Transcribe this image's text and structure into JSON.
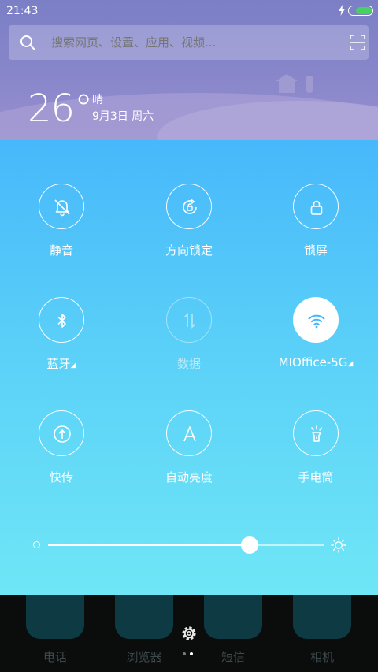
{
  "status_bar": {
    "time": "21:43"
  },
  "search": {
    "placeholder": "搜索网页、设置、应用、视频..."
  },
  "weather": {
    "temperature": "26°",
    "condition": "晴",
    "date": "9月3日 周六"
  },
  "toggles": [
    {
      "label": "静音",
      "icon": "silent-bell-icon",
      "state": "off"
    },
    {
      "label": "方向锁定",
      "icon": "rotation-lock-icon",
      "state": "off"
    },
    {
      "label": "锁屏",
      "icon": "lock-icon",
      "state": "off"
    },
    {
      "label": "蓝牙",
      "icon": "bluetooth-icon",
      "state": "off",
      "has_menu": true
    },
    {
      "label": "数据",
      "icon": "mobile-data-icon",
      "state": "disabled"
    },
    {
      "label": "MIOffice-5G",
      "icon": "wifi-icon",
      "state": "on",
      "has_menu": true
    },
    {
      "label": "快传",
      "icon": "quick-transfer-icon",
      "state": "off"
    },
    {
      "label": "自动亮度",
      "icon": "auto-brightness-icon",
      "state": "off"
    },
    {
      "label": "手电筒",
      "icon": "flashlight-icon",
      "state": "off"
    }
  ],
  "brightness": {
    "level": 0.73
  },
  "dock": {
    "apps": [
      {
        "label": "电话",
        "icon": "phone-icon"
      },
      {
        "label": "浏览器",
        "icon": "browser-icon"
      },
      {
        "label": "短信",
        "icon": "messages-icon"
      },
      {
        "label": "相机",
        "icon": "camera-icon"
      }
    ],
    "page_count": 2,
    "current_page": 2
  },
  "colors": {
    "header_bg": "#8a87cb",
    "panel_top": "#47b8fa",
    "panel_bottom": "#6fe6f6",
    "wifi_active_icon": "#47b8fa",
    "battery_fill": "#46d160"
  }
}
